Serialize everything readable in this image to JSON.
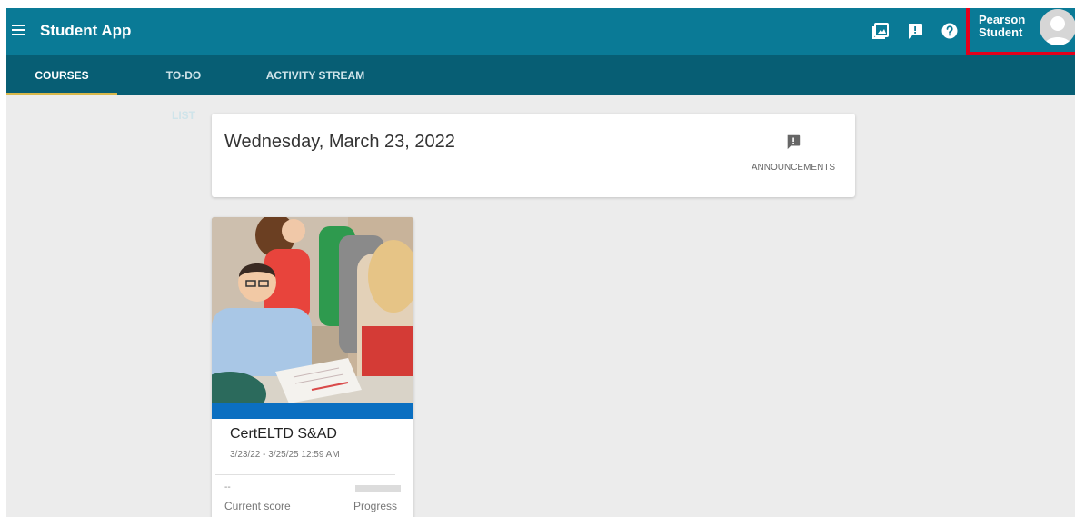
{
  "header": {
    "menu_icon": "hamburger-menu-icon",
    "title": "Student App",
    "icons": [
      "gallery-icon",
      "announcement-icon",
      "help-icon"
    ],
    "user": {
      "first_name": "Pearson",
      "last_name": "Student",
      "avatar_icon": "user-avatar-icon"
    },
    "highlight_color": "#e3001b"
  },
  "tabs": [
    {
      "label": "COURSES",
      "active": true
    },
    {
      "label": "TO-DO LIST",
      "active": false
    },
    {
      "label": "ACTIVITY STREAM",
      "active": false
    }
  ],
  "date_card": {
    "date": "Wednesday, March 23, 2022",
    "announcements_label": "ANNOUNCEMENTS",
    "announcements_icon": "announcement-icon"
  },
  "course": {
    "title": "CertELTD S&AD",
    "dates": "3/23/22 - 3/25/25 12:59 AM",
    "current_score_value": "--",
    "current_score_label": "Current score",
    "progress_label": "Progress",
    "progress": 0,
    "band_color": "#0b6fc1"
  },
  "colors": {
    "topbar": "#0a7a96",
    "tabbar": "#075e74",
    "active_tab_indicator": "#d9b84a",
    "background": "#ececec"
  }
}
